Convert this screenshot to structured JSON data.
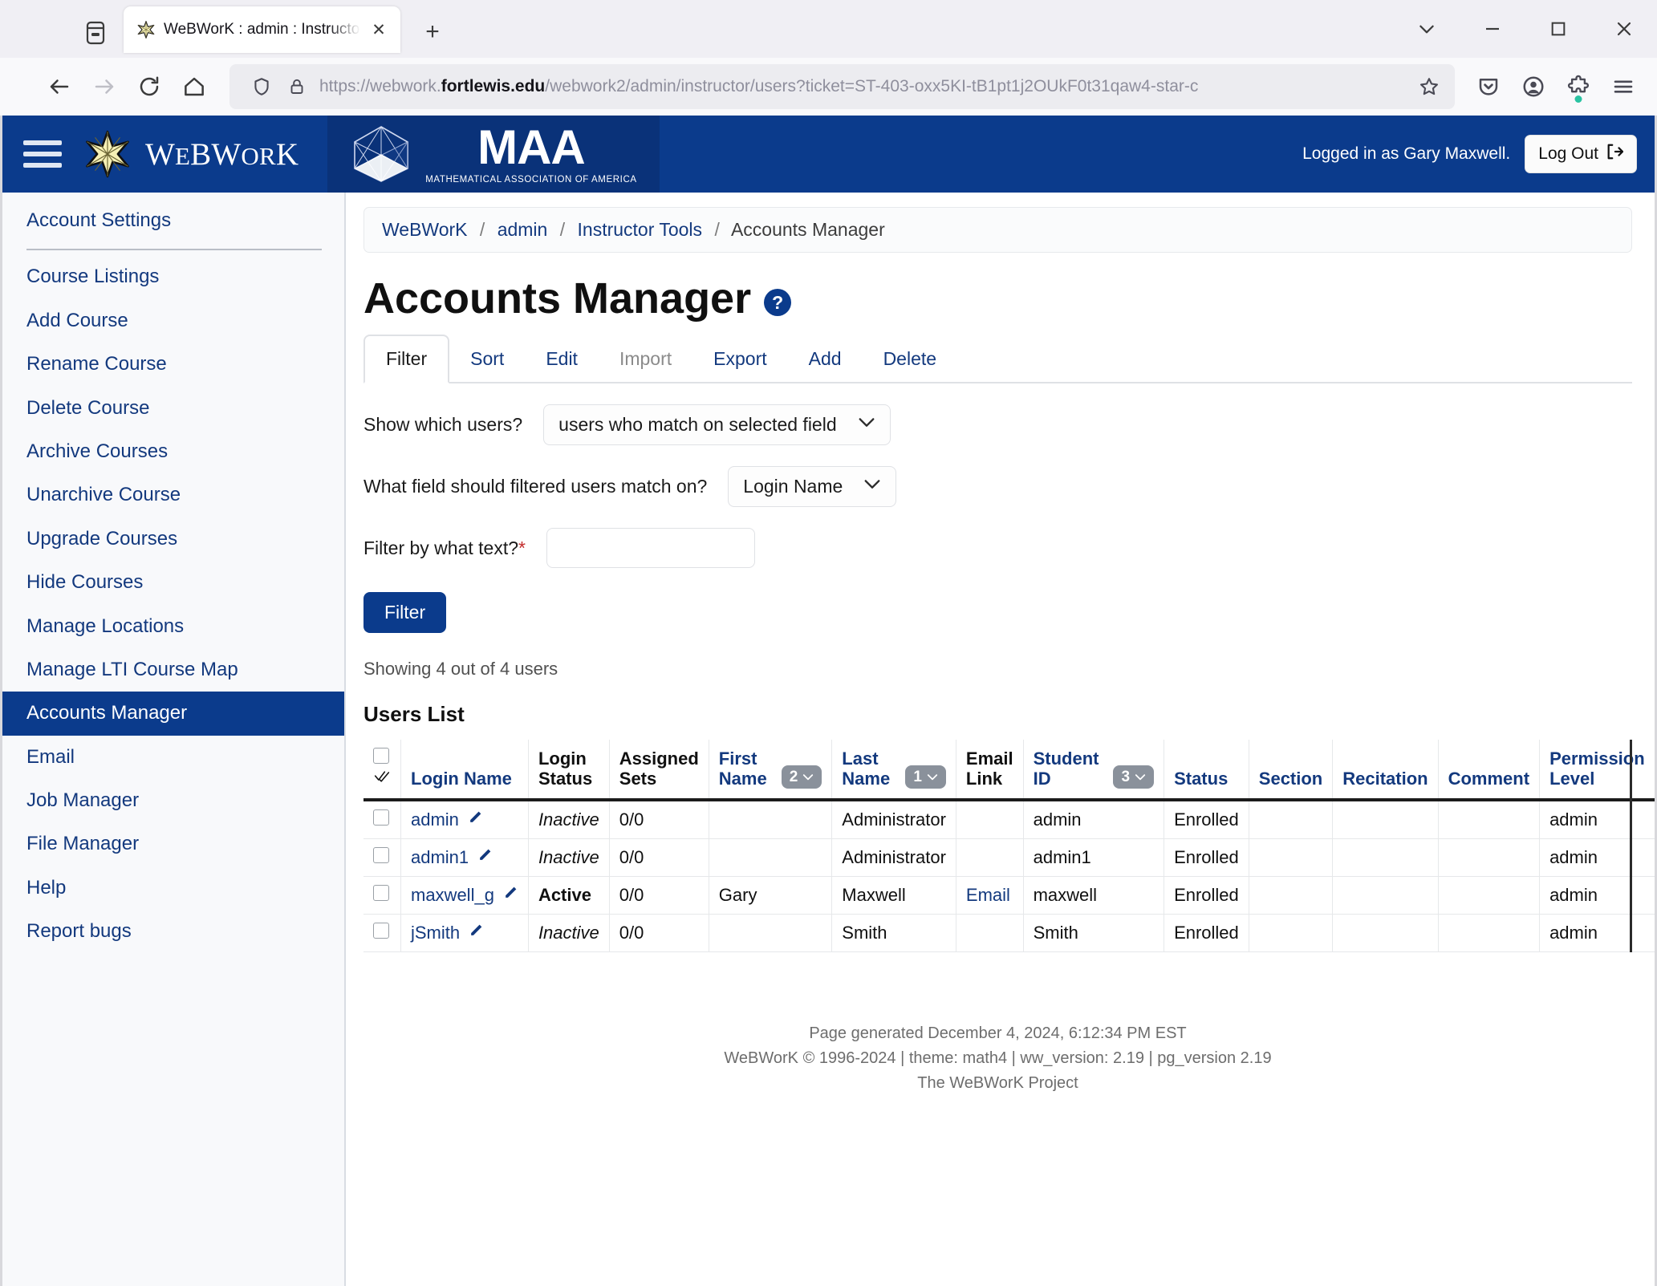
{
  "browser": {
    "tab": {
      "title": "WeBWorK : admin : Instructor Tools",
      "favicon_name": "webwork-star-favicon",
      "close_label": "✕"
    },
    "new_tab_label": "+",
    "url": {
      "scheme": "https://webwork.",
      "domain": "fortlewis.edu",
      "path": "/webwork2/admin/instructor/users?ticket=ST-403-oxx5KI-tB1pt1j2OUkF0t31qaw4-star-c"
    },
    "window_controls": {
      "list_all_tabs": "list-all-tabs",
      "minimize": "–",
      "maximize": "□",
      "close": "✕"
    }
  },
  "ww_header": {
    "wordmark_w": "W",
    "wordmark_e": "E",
    "wordmark_b": "B",
    "wordmark_w2": "W",
    "wordmark_or": "OR",
    "wordmark_k": "K",
    "brand": "WeBWorK",
    "maa_abbr": "MAA",
    "maa_full": "MATHEMATICAL ASSOCIATION OF AMERICA",
    "logged_in_text": "Logged in as Gary Maxwell.",
    "logout_label": "Log Out"
  },
  "sidebar": {
    "items": [
      {
        "label": "Account Settings",
        "active": false,
        "divider_after": true
      },
      {
        "label": "Course Listings",
        "active": false
      },
      {
        "label": "Add Course",
        "active": false
      },
      {
        "label": "Rename Course",
        "active": false
      },
      {
        "label": "Delete Course",
        "active": false
      },
      {
        "label": "Archive Courses",
        "active": false
      },
      {
        "label": "Unarchive Course",
        "active": false
      },
      {
        "label": "Upgrade Courses",
        "active": false
      },
      {
        "label": "Hide Courses",
        "active": false
      },
      {
        "label": "Manage Locations",
        "active": false
      },
      {
        "label": "Manage LTI Course Map",
        "active": false
      },
      {
        "label": "Accounts Manager",
        "active": true
      },
      {
        "label": "Email",
        "active": false
      },
      {
        "label": "Job Manager",
        "active": false
      },
      {
        "label": "File Manager",
        "active": false
      },
      {
        "label": "Help",
        "active": false
      },
      {
        "label": "Report bugs",
        "active": false
      }
    ]
  },
  "breadcrumb": {
    "items": [
      "WeBWorK",
      "admin",
      "Instructor Tools",
      "Accounts Manager"
    ],
    "separator": "/"
  },
  "page": {
    "title": "Accounts Manager",
    "help_badge": "?",
    "tabs": [
      {
        "label": "Filter",
        "state": "active"
      },
      {
        "label": "Sort",
        "state": "normal"
      },
      {
        "label": "Edit",
        "state": "normal"
      },
      {
        "label": "Import",
        "state": "disabled"
      },
      {
        "label": "Export",
        "state": "normal"
      },
      {
        "label": "Add",
        "state": "normal"
      },
      {
        "label": "Delete",
        "state": "normal"
      }
    ]
  },
  "filter_form": {
    "show_which_label": "Show which users?",
    "show_which_value": "users who match on selected field",
    "match_field_label": "What field should filtered users match on?",
    "match_field_value": "Login Name",
    "filter_text_label": "Filter by what text?",
    "required_marker": "*",
    "filter_text_value": "",
    "filter_text_placeholder": "",
    "submit_label": "Filter"
  },
  "results": {
    "showing": "Showing 4 out of 4 users",
    "list_title": "Users List"
  },
  "table": {
    "select_all_icon": "check-all-icon",
    "columns": [
      {
        "label": "Login Name",
        "sortable": true,
        "badge": null
      },
      {
        "label": "Login Status",
        "sortable": false,
        "badge": null
      },
      {
        "label": "Assigned Sets",
        "sortable": false,
        "badge": null
      },
      {
        "label": "First Name",
        "sortable": true,
        "badge": "2"
      },
      {
        "label": "Last Name",
        "sortable": true,
        "badge": "1"
      },
      {
        "label": "Email Link",
        "sortable": false,
        "badge": null
      },
      {
        "label": "Student ID",
        "sortable": true,
        "badge": "3"
      },
      {
        "label": "Status",
        "sortable": true,
        "badge": null
      },
      {
        "label": "Section",
        "sortable": true,
        "badge": null
      },
      {
        "label": "Recitation",
        "sortable": true,
        "badge": null
      },
      {
        "label": "Comment",
        "sortable": true,
        "badge": null
      },
      {
        "label": "Permission Level",
        "sortable": true,
        "badge": null
      }
    ],
    "rows": [
      {
        "login_name": "admin",
        "login_status": "Inactive",
        "assigned_sets": "0/0",
        "first_name": "",
        "last_name": "Administrator",
        "email_link": "",
        "student_id": "admin",
        "status": "Enrolled",
        "section": "",
        "recitation": "",
        "comment": "",
        "permission_level": "admin"
      },
      {
        "login_name": "admin1",
        "login_status": "Inactive",
        "assigned_sets": "0/0",
        "first_name": "",
        "last_name": "Administrator",
        "email_link": "",
        "student_id": "admin1",
        "status": "Enrolled",
        "section": "",
        "recitation": "",
        "comment": "",
        "permission_level": "admin"
      },
      {
        "login_name": "maxwell_g",
        "login_status": "Active",
        "assigned_sets": "0/0",
        "first_name": "Gary",
        "last_name": "Maxwell",
        "email_link": "Email",
        "student_id": "maxwell",
        "status": "Enrolled",
        "section": "",
        "recitation": "",
        "comment": "",
        "permission_level": "admin"
      },
      {
        "login_name": "jSmith",
        "login_status": "Inactive",
        "assigned_sets": "0/0",
        "first_name": "",
        "last_name": "Smith",
        "email_link": "",
        "student_id": "Smith",
        "status": "Enrolled",
        "section": "",
        "recitation": "",
        "comment": "",
        "permission_level": "admin"
      }
    ]
  },
  "footer": {
    "line1": "Page generated December 4, 2024, 6:12:34 PM EST",
    "line2": "WeBWorK © 1996-2024 | theme: math4 | ww_version: 2.19 | pg_version 2.19",
    "line3": "The WeBWorK Project"
  },
  "colors": {
    "brand_blue": "#0b3b8c",
    "link_blue": "#13397e",
    "maa_blue": "#0a3279",
    "accent_green": "#2ac3a2",
    "required_red": "#c32b2b"
  }
}
